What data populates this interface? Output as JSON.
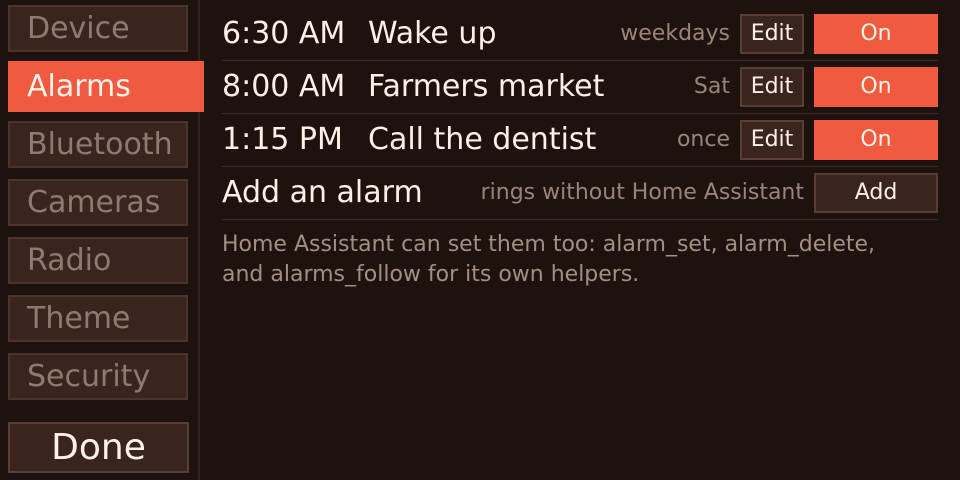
{
  "sidebar": {
    "items": [
      {
        "label": "Device",
        "active": false
      },
      {
        "label": "Alarms",
        "active": true
      },
      {
        "label": "Bluetooth",
        "active": false
      },
      {
        "label": "Cameras",
        "active": false
      },
      {
        "label": "Radio",
        "active": false
      },
      {
        "label": "Theme",
        "active": false
      },
      {
        "label": "Security",
        "active": false
      }
    ],
    "done_label": "Done"
  },
  "alarms": [
    {
      "time": "6:30 AM",
      "name": "Wake up",
      "repeat": "weekdays",
      "edit_label": "Edit",
      "toggle_label": "On"
    },
    {
      "time": "8:00 AM",
      "name": "Farmers market",
      "repeat": "Sat",
      "edit_label": "Edit",
      "toggle_label": "On"
    },
    {
      "time": "1:15 PM",
      "name": "Call the dentist",
      "repeat": "once",
      "edit_label": "Edit",
      "toggle_label": "On"
    }
  ],
  "add_alarm": {
    "title": "Add an alarm",
    "hint": "rings without Home Assistant",
    "button_label": "Add"
  },
  "info": {
    "line1": "Home Assistant can set them too: alarm_set, alarm_delete,",
    "line2": "and alarms_follow for its own helpers."
  },
  "colors": {
    "background": "#1e120f",
    "accent": "#f05a3e",
    "button": "#3a241e",
    "text": "#fff0e7",
    "muted_text": "#9a8479"
  }
}
